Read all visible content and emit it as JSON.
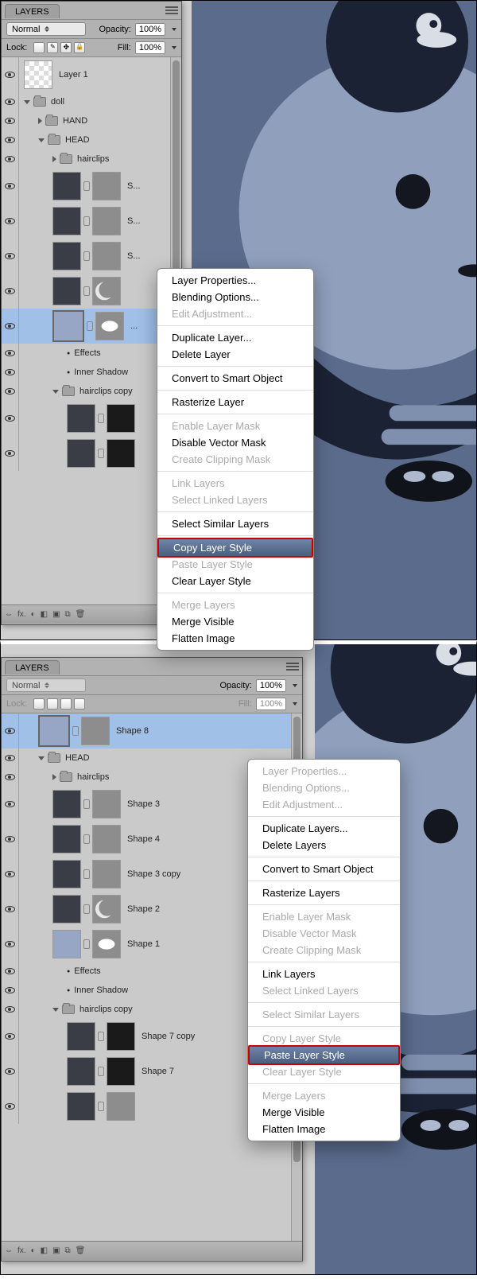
{
  "panel_title": "LAYERS",
  "blend_mode": "Normal",
  "opacity_label": "Opacity:",
  "fill_label": "Fill:",
  "lock_label": "Lock:",
  "percent": "100%",
  "section1": {
    "layers": [
      {
        "type": "layer",
        "name": "Layer 1",
        "indent": 0,
        "tall": true,
        "trans": true
      },
      {
        "type": "folder",
        "name": "doll",
        "indent": 0,
        "open": true
      },
      {
        "type": "folder",
        "name": "HAND",
        "indent": 1,
        "open": false
      },
      {
        "type": "folder",
        "name": "HEAD",
        "indent": 1,
        "open": true
      },
      {
        "type": "folder",
        "name": "hairclips",
        "indent": 2,
        "open": false
      },
      {
        "type": "shape",
        "name": "S...",
        "indent": 2,
        "tall": true
      },
      {
        "type": "shape",
        "name": "S...",
        "indent": 2,
        "tall": true
      },
      {
        "type": "shape",
        "name": "S...",
        "indent": 2,
        "tall": true
      },
      {
        "type": "shape",
        "name": "",
        "indent": 2,
        "tall": true,
        "mask": "moon"
      },
      {
        "type": "shape",
        "name": "...",
        "indent": 2,
        "tall": true,
        "sel": true,
        "light": true,
        "mask": "oval"
      },
      {
        "type": "fx",
        "name": "Effects",
        "indent": 3
      },
      {
        "type": "fx",
        "name": "Inner Shadow",
        "indent": 3
      },
      {
        "type": "folder",
        "name": "hairclips copy",
        "indent": 2,
        "open": true
      },
      {
        "type": "shape",
        "name": "",
        "indent": 3,
        "tall": true,
        "blackmask": true
      },
      {
        "type": "shape",
        "name": "",
        "indent": 3,
        "tall": true,
        "blackmask": true
      }
    ],
    "menu_highlight": "Copy Layer Style",
    "menu": [
      [
        "Layer Properties...",
        "Blending Options...",
        "-Edit Adjustment..."
      ],
      [
        "Duplicate Layer...",
        "Delete Layer"
      ],
      [
        "Convert to Smart Object"
      ],
      [
        "Rasterize Layer"
      ],
      [
        "-Enable Layer Mask",
        "Disable Vector Mask",
        "-Create Clipping Mask"
      ],
      [
        "-Link Layers",
        "-Select Linked Layers"
      ],
      [
        "Select Similar Layers"
      ],
      [
        "*Copy Layer Style",
        "-Paste Layer Style",
        "Clear Layer Style"
      ],
      [
        "-Merge Layers",
        "Merge Visible",
        "Flatten Image"
      ]
    ]
  },
  "section2": {
    "layers": [
      {
        "type": "shape",
        "name": "Shape 8",
        "indent": 1,
        "tall": true,
        "sel": true,
        "light": true
      },
      {
        "type": "folder",
        "name": "HEAD",
        "indent": 1,
        "open": true
      },
      {
        "type": "folder",
        "name": "hairclips",
        "indent": 2,
        "open": false
      },
      {
        "type": "shape",
        "name": "Shape 3",
        "indent": 2,
        "tall": true
      },
      {
        "type": "shape",
        "name": "Shape 4",
        "indent": 2,
        "tall": true
      },
      {
        "type": "shape",
        "name": "Shape 3 copy",
        "indent": 2,
        "tall": true
      },
      {
        "type": "shape",
        "name": "Shape 2",
        "indent": 2,
        "tall": true,
        "mask": "moon"
      },
      {
        "type": "shape",
        "name": "Shape 1",
        "indent": 2,
        "tall": true,
        "light": true,
        "mask": "oval"
      },
      {
        "type": "fx",
        "name": "Effects",
        "indent": 3
      },
      {
        "type": "fx",
        "name": "Inner Shadow",
        "indent": 3
      },
      {
        "type": "folder",
        "name": "hairclips copy",
        "indent": 2,
        "open": true
      },
      {
        "type": "shape",
        "name": "Shape 7 copy",
        "indent": 3,
        "tall": true,
        "blackmask": true
      },
      {
        "type": "shape",
        "name": "Shape 7",
        "indent": 3,
        "tall": true,
        "blackmask": true
      },
      {
        "type": "shape",
        "name": "",
        "indent": 3,
        "tall": true
      }
    ],
    "menu_highlight": "Paste Layer Style",
    "menu": [
      [
        "-Layer Properties...",
        "-Blending Options...",
        "-Edit Adjustment..."
      ],
      [
        "Duplicate Layers...",
        "Delete Layers"
      ],
      [
        "Convert to Smart Object"
      ],
      [
        "Rasterize Layers"
      ],
      [
        "-Enable Layer Mask",
        "-Disable Vector Mask",
        "-Create Clipping Mask"
      ],
      [
        "Link Layers",
        "-Select Linked Layers"
      ],
      [
        "-Select Similar Layers"
      ],
      [
        "-Copy Layer Style",
        "*Paste Layer Style",
        "-Clear Layer Style"
      ],
      [
        "-Merge Layers",
        "Merge Visible",
        "Flatten Image"
      ]
    ]
  },
  "footer_icons": [
    "⇔",
    "fx.",
    "◐",
    "◧",
    "▣",
    "⧉",
    "🗑"
  ]
}
